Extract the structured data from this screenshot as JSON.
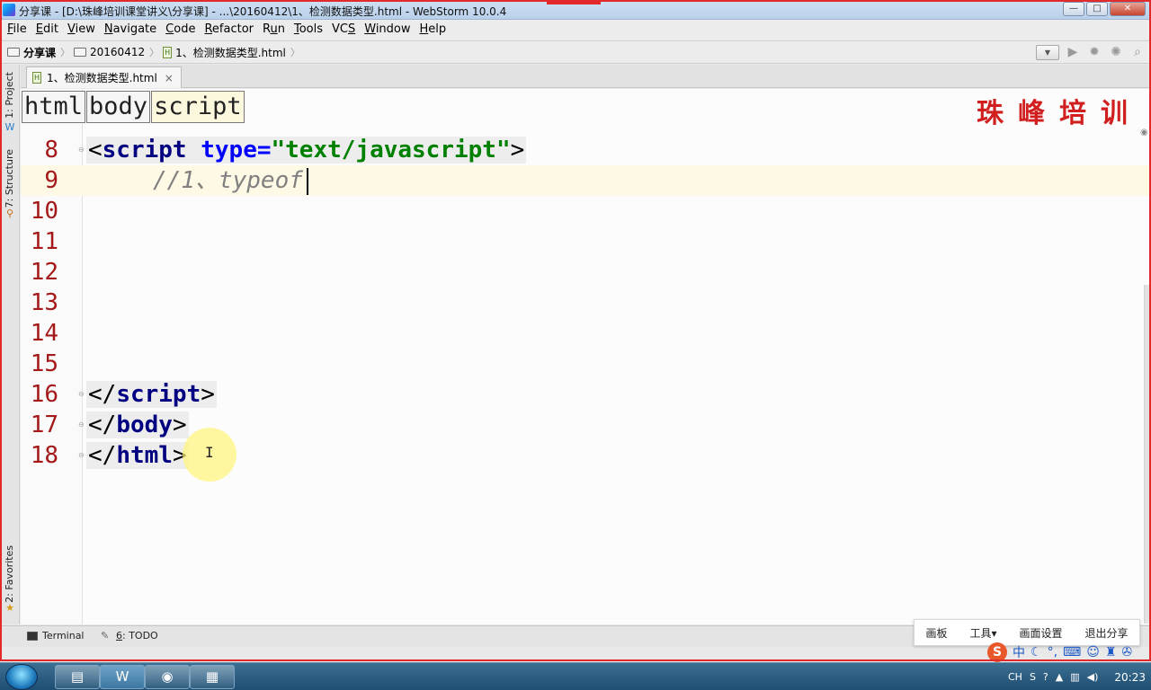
{
  "window": {
    "title": "分享课 - [D:\\珠峰培训课堂讲义\\分享课] - ...\\20160412\\1、检测数据类型.html - WebStorm 10.0.4",
    "buttons": {
      "minimize": "—",
      "maximize": "□",
      "close": "✕"
    }
  },
  "menu": [
    {
      "pre": "",
      "key": "F",
      "post": "ile"
    },
    {
      "pre": "",
      "key": "E",
      "post": "dit"
    },
    {
      "pre": "",
      "key": "V",
      "post": "iew"
    },
    {
      "pre": "",
      "key": "N",
      "post": "avigate"
    },
    {
      "pre": "",
      "key": "C",
      "post": "ode"
    },
    {
      "pre": "",
      "key": "R",
      "post": "efactor"
    },
    {
      "pre": "R",
      "key": "u",
      "post": "n"
    },
    {
      "pre": "",
      "key": "T",
      "post": "ools"
    },
    {
      "pre": "VC",
      "key": "S",
      "post": ""
    },
    {
      "pre": "",
      "key": "W",
      "post": "indow"
    },
    {
      "pre": "",
      "key": "H",
      "post": "elp"
    }
  ],
  "nav": {
    "project": "分享课",
    "folder": "20160412",
    "file": "1、检测数据类型.html",
    "icons": [
      "dropdown-arrow",
      "run-icon",
      "debug-icon",
      "coverage-icon",
      "search-icon"
    ]
  },
  "left_strip": {
    "project_tab": "1: Project",
    "structure_tab": "7: Structure",
    "favorites_tab": "2: Favorites"
  },
  "editor_tab": {
    "label": "1、检测数据类型.html",
    "close": "×"
  },
  "tag_breadcrumbs": [
    "html",
    "body",
    "script"
  ],
  "brand_text": "珠峰培训",
  "code_lines": [
    {
      "num": "8"
    },
    {
      "num": "9"
    },
    {
      "num": "10"
    },
    {
      "num": "11"
    },
    {
      "num": "12"
    },
    {
      "num": "13"
    },
    {
      "num": "14"
    },
    {
      "num": "15"
    },
    {
      "num": "16"
    },
    {
      "num": "17"
    },
    {
      "num": "18"
    }
  ],
  "code": {
    "l8_open": "<",
    "l8_tag": "script",
    "l8_attr": " type=",
    "l8_str": "\"text/javascript\"",
    "l8_close": ">",
    "l9_comment": "//1、typeof",
    "l16_open": "</",
    "l16_tag": "script",
    "l16_close": ">",
    "l17_open": "</",
    "l17_tag": "body",
    "l17_close": ">",
    "l18_open": "</",
    "l18_tag": "html",
    "l18_close": ">",
    "mouse_cursor": "I"
  },
  "bottom_tools": {
    "terminal": "Terminal",
    "todo_key": "6",
    "todo_rest": ": TODO"
  },
  "share_panel": {
    "board": "画板",
    "tools": "工具",
    "tools_arrow": "▾",
    "screen_settings": "画面设置",
    "exit_share": "退出分享"
  },
  "ime": {
    "logo": "S",
    "mode": "中",
    "icons": [
      "moon-icon",
      "punctuation-icon",
      "keyboard-icon",
      "user-icon",
      "shirt-icon",
      "wrench-icon"
    ]
  },
  "taskbar": {
    "apps": [
      "explorer-icon",
      "webstorm-icon",
      "chrome-icon",
      "files-icon"
    ],
    "tray_lang": "CH",
    "clock": "20:23"
  },
  "colors": {
    "line_number": "#a4191a",
    "tag": "#000080",
    "attr": "#0000ff",
    "string": "#008000",
    "comment": "#808080",
    "brand": "#d11e1e"
  }
}
